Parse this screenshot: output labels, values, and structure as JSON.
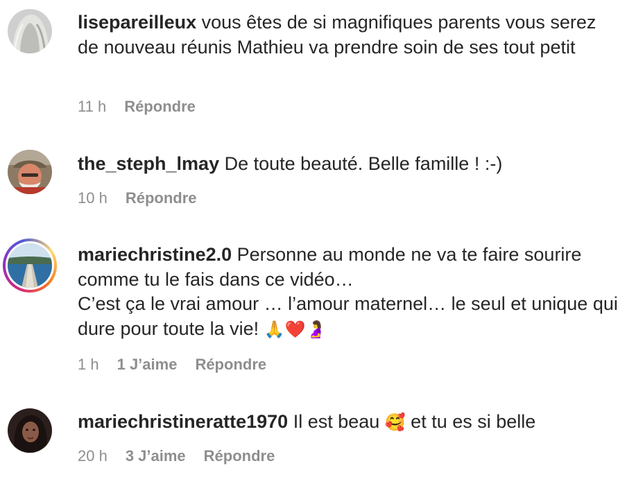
{
  "comments": [
    {
      "username": "lisepareilleux",
      "text": "vous êtes de si magnifiques parents vous serez de nouveau réunis Mathieu va prendre soin de ses tout petit",
      "time": "11 h",
      "likes": "",
      "reply_label": "Répondre",
      "avatar_icon": "avatar-grey-hair"
    },
    {
      "username": "the_steph_lmay",
      "text": "De toute beauté. Belle famille ! :-)",
      "time": "10 h",
      "likes": "",
      "reply_label": "Répondre",
      "avatar_icon": "avatar-man-hat"
    },
    {
      "username": "mariechristine2.0",
      "text": "Personne au monde ne va te faire sourire comme tu le fais dans ce vidéo…\nC’est ça le vrai amour … l’amour maternel… le seul et unique qui dure pour toute la vie! ",
      "emojis": "🙏❤️🤰",
      "time": "1 h",
      "likes": "1 J’aime",
      "reply_label": "Répondre",
      "avatar_icon": "avatar-pier-with-story-ring"
    },
    {
      "username": "mariechristineratte1970",
      "text": "Il est beau ",
      "emoji": "🥰",
      "text_after": " et tu es si belle",
      "time": "20 h",
      "likes": "3 J’aime",
      "reply_label": "Répondre",
      "avatar_icon": "avatar-woman-dark"
    }
  ],
  "colors": {
    "text": "#262626",
    "secondary": "#8e8e8e",
    "story_ring": [
      "#d62976",
      "#962fbf",
      "#4f5bd5",
      "#feda75",
      "#fa7e1e"
    ]
  }
}
